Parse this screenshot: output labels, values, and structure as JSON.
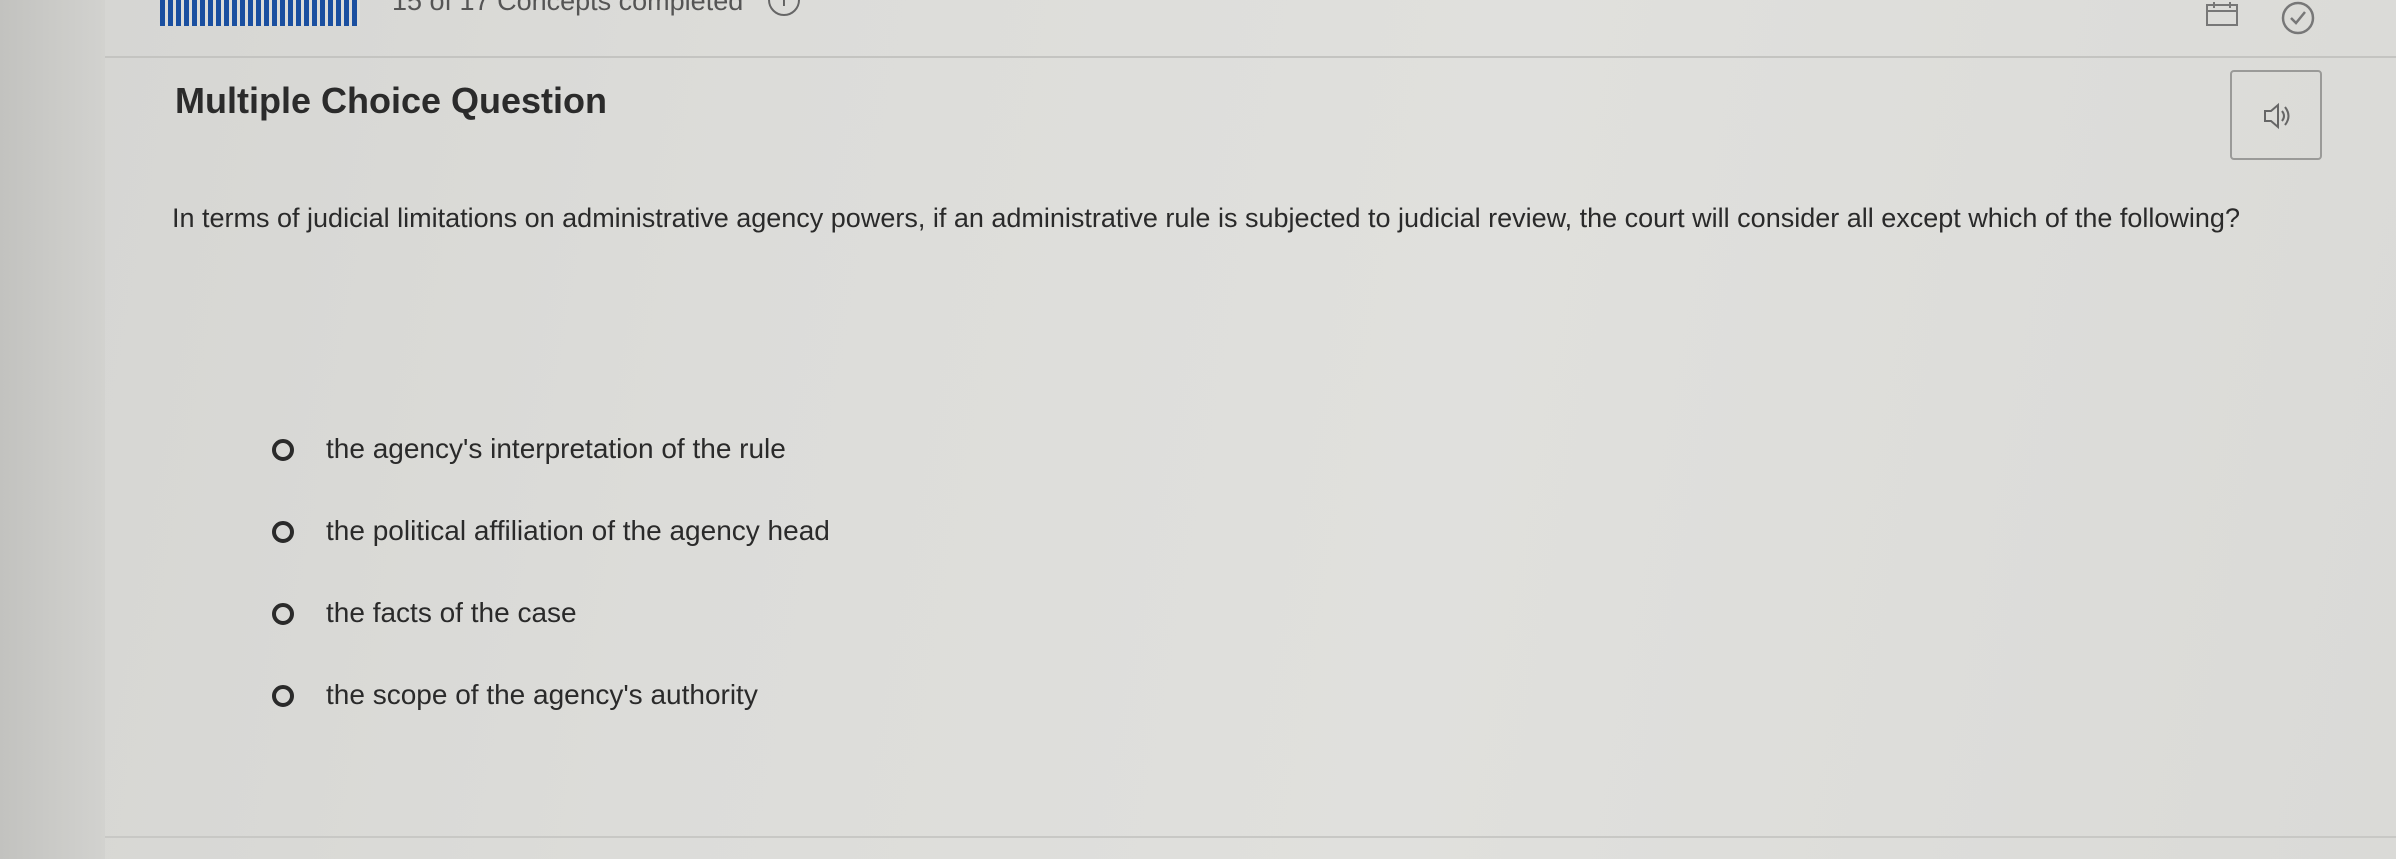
{
  "header": {
    "progress_text": "15 of 17 Concepts completed",
    "progress_info_glyph": "i",
    "calendar_icon": "calendar-icon",
    "check_icon": "check-circle-icon"
  },
  "question": {
    "type_label": "Multiple Choice Question",
    "audio_icon": "speaker-icon",
    "text": "In terms of judicial limitations on administrative agency powers, if an administrative rule is subjected to judicial review, the court will consider all except which of the following?",
    "options": [
      {
        "label": "the agency's interpretation of the rule"
      },
      {
        "label": "the political affiliation of the agency head"
      },
      {
        "label": "the facts of the case"
      },
      {
        "label": "the scope of the agency's authority"
      }
    ]
  },
  "colors": {
    "progress_segment": "#1a4fa0",
    "background": "#dcdcd9",
    "text": "#2a2a2a"
  }
}
